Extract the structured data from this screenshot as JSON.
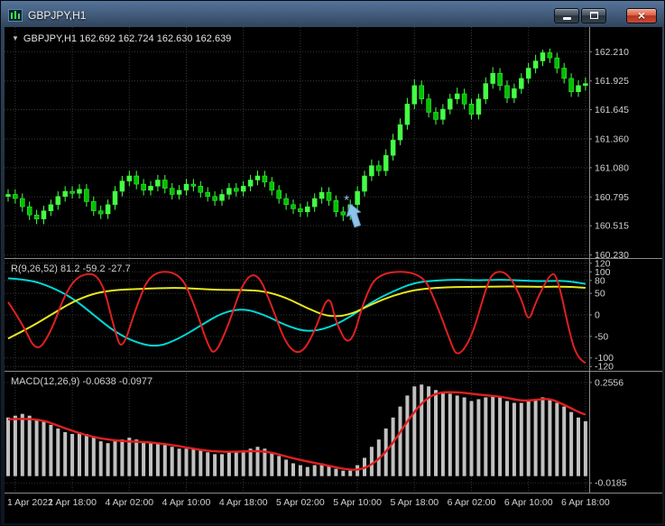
{
  "window": {
    "title": "GBPJPY,H1",
    "controls": {
      "close_glyph": "×"
    }
  },
  "overlay": {
    "collapse_icon": "▼",
    "ohlc_line": "GBPJPY,H1 162.692 162.724 162.630 162.639"
  },
  "panels": {
    "r_label": "R(9,26,52) 81.2 -59.2 -27.7",
    "macd_label": "MACD(12,26,9) -0.0638 -0.0977"
  },
  "axes": {
    "price": [
      "162.210",
      "161.925",
      "161.645",
      "161.360",
      "161.080",
      "160.795",
      "160.515",
      "160.230"
    ],
    "r": [
      "120",
      "100",
      "80",
      "50",
      "0",
      "-50",
      "-100",
      "-120"
    ],
    "macd": [
      "0.2556",
      "-0.0185"
    ],
    "time": [
      "1 Apr 2022",
      "1 Apr 18:00",
      "4 Apr 02:00",
      "4 Apr 10:00",
      "4 Apr 18:00",
      "5 Apr 02:00",
      "5 Apr 10:00",
      "5 Apr 18:00",
      "6 Apr 02:00",
      "6 Apr 10:00",
      "6 Apr 18:00"
    ]
  },
  "colors": {
    "background": "#000000",
    "bull": "#44ff44",
    "bear": "#00c000",
    "wick": "#44ff44",
    "grid": "#383838",
    "separator": "#8a8a8a",
    "axis_text": "#d2d2d2",
    "annotation": "#8fc3ea"
  },
  "chart_data": {
    "type": "candlestick",
    "symbol": "GBPJPY",
    "timeframe": "H1",
    "title": "GBPJPY,H1",
    "price_range": [
      160.2,
      162.45
    ],
    "time_grid_candles": [
      1,
      9,
      17,
      25,
      33,
      41,
      49,
      57,
      65,
      73,
      81
    ],
    "candles": [
      [
        160.8,
        160.87,
        160.75,
        160.82
      ],
      [
        160.82,
        160.87,
        160.73,
        160.78
      ],
      [
        160.78,
        160.83,
        160.65,
        160.7
      ],
      [
        160.7,
        160.75,
        160.57,
        160.62
      ],
      [
        160.62,
        160.67,
        160.53,
        160.58
      ],
      [
        160.58,
        160.71,
        160.53,
        160.66
      ],
      [
        160.66,
        160.77,
        160.61,
        160.72
      ],
      [
        160.72,
        160.85,
        160.67,
        160.8
      ],
      [
        160.8,
        160.9,
        160.75,
        160.85
      ],
      [
        160.85,
        160.9,
        160.78,
        160.83
      ],
      [
        160.83,
        160.92,
        160.78,
        160.87
      ],
      [
        160.87,
        160.92,
        160.7,
        160.75
      ],
      [
        160.75,
        160.8,
        160.61,
        160.66
      ],
      [
        160.66,
        160.71,
        160.58,
        160.63
      ],
      [
        160.63,
        160.77,
        160.58,
        160.72
      ],
      [
        160.72,
        160.9,
        160.67,
        160.85
      ],
      [
        160.85,
        161.0,
        160.8,
        160.95
      ],
      [
        160.95,
        161.05,
        160.9,
        161.0
      ],
      [
        161.0,
        161.05,
        160.87,
        160.92
      ],
      [
        160.92,
        160.97,
        160.81,
        160.86
      ],
      [
        160.86,
        160.95,
        160.81,
        160.9
      ],
      [
        160.9,
        161.01,
        160.85,
        160.96
      ],
      [
        160.96,
        161.01,
        160.83,
        160.88
      ],
      [
        160.88,
        160.93,
        160.77,
        160.82
      ],
      [
        160.82,
        160.91,
        160.77,
        160.86
      ],
      [
        160.86,
        160.97,
        160.81,
        160.92
      ],
      [
        160.92,
        160.97,
        160.85,
        160.9
      ],
      [
        160.9,
        160.95,
        160.79,
        160.84
      ],
      [
        160.84,
        160.89,
        160.75,
        160.8
      ],
      [
        160.8,
        160.85,
        160.71,
        160.76
      ],
      [
        160.76,
        160.87,
        160.71,
        160.82
      ],
      [
        160.82,
        160.93,
        160.77,
        160.88
      ],
      [
        160.88,
        160.93,
        160.8,
        160.85
      ],
      [
        160.85,
        160.95,
        160.8,
        160.9
      ],
      [
        160.9,
        161.01,
        160.85,
        160.96
      ],
      [
        160.96,
        161.05,
        160.91,
        161.0
      ],
      [
        161.0,
        161.05,
        160.89,
        160.94
      ],
      [
        160.94,
        160.99,
        160.81,
        160.86
      ],
      [
        160.86,
        160.91,
        160.73,
        160.78
      ],
      [
        160.78,
        160.83,
        160.67,
        160.72
      ],
      [
        160.72,
        160.77,
        160.63,
        160.68
      ],
      [
        160.68,
        160.73,
        160.6,
        160.65
      ],
      [
        160.65,
        160.75,
        160.6,
        160.7
      ],
      [
        160.7,
        160.83,
        160.65,
        160.78
      ],
      [
        160.78,
        160.89,
        160.73,
        160.84
      ],
      [
        160.84,
        160.89,
        160.71,
        160.76
      ],
      [
        160.76,
        160.81,
        160.6,
        160.65
      ],
      [
        160.65,
        160.7,
        160.56,
        160.62
      ],
      [
        160.62,
        160.77,
        160.57,
        160.72
      ],
      [
        160.72,
        160.9,
        160.67,
        160.85
      ],
      [
        160.85,
        161.05,
        160.8,
        161.0
      ],
      [
        161.0,
        161.16,
        160.95,
        161.1
      ],
      [
        161.1,
        161.15,
        161.0,
        161.05
      ],
      [
        161.05,
        161.26,
        161.0,
        161.2
      ],
      [
        161.2,
        161.41,
        161.15,
        161.35
      ],
      [
        161.35,
        161.56,
        161.3,
        161.5
      ],
      [
        161.5,
        161.76,
        161.45,
        161.7
      ],
      [
        161.7,
        161.94,
        161.65,
        161.88
      ],
      [
        161.88,
        161.93,
        161.7,
        161.75
      ],
      [
        161.75,
        161.8,
        161.57,
        161.62
      ],
      [
        161.62,
        161.67,
        161.5,
        161.55
      ],
      [
        161.55,
        161.7,
        161.5,
        161.65
      ],
      [
        161.65,
        161.8,
        161.6,
        161.75
      ],
      [
        161.75,
        161.86,
        161.7,
        161.8
      ],
      [
        161.8,
        161.85,
        161.65,
        161.7
      ],
      [
        161.7,
        161.75,
        161.55,
        161.6
      ],
      [
        161.6,
        161.8,
        161.55,
        161.75
      ],
      [
        161.75,
        161.96,
        161.7,
        161.9
      ],
      [
        161.9,
        162.06,
        161.85,
        162.0
      ],
      [
        162.0,
        162.05,
        161.83,
        161.88
      ],
      [
        161.88,
        161.93,
        161.71,
        161.76
      ],
      [
        161.76,
        161.9,
        161.71,
        161.85
      ],
      [
        161.85,
        162.0,
        161.8,
        161.95
      ],
      [
        161.95,
        162.1,
        161.9,
        162.05
      ],
      [
        162.05,
        162.18,
        162.0,
        162.12
      ],
      [
        162.12,
        162.23,
        162.07,
        162.2
      ],
      [
        162.2,
        162.24,
        162.1,
        162.15
      ],
      [
        162.15,
        162.2,
        162.0,
        162.05
      ],
      [
        162.05,
        162.1,
        161.9,
        161.95
      ],
      [
        161.95,
        162.0,
        161.77,
        161.82
      ],
      [
        161.82,
        161.93,
        161.77,
        161.88
      ],
      [
        161.88,
        161.96,
        161.83,
        161.9
      ]
    ],
    "indicators": [
      {
        "name": "R(9,26,52)",
        "range": [
          -130,
          130
        ],
        "series": [
          {
            "name": "fast",
            "color": "#e02020",
            "points": [
              [
                0,
                30
              ],
              [
                2,
                -20
              ],
              [
                4,
                -90
              ],
              [
                6,
                -40
              ],
              [
                8,
                50
              ],
              [
                10,
                95
              ],
              [
                13,
                95
              ],
              [
                15,
                -40
              ],
              [
                16,
                -85
              ],
              [
                18,
                20
              ],
              [
                20,
                100
              ],
              [
                24,
                100
              ],
              [
                26,
                30
              ],
              [
                28,
                -70
              ],
              [
                29,
                -95
              ],
              [
                31,
                -20
              ],
              [
                33,
                80
              ],
              [
                35,
                100
              ],
              [
                37,
                20
              ],
              [
                39,
                -70
              ],
              [
                41,
                -95
              ],
              [
                43,
                -40
              ],
              [
                45,
                55
              ],
              [
                46,
                -20
              ],
              [
                48,
                -80
              ],
              [
                50,
                40
              ],
              [
                52,
                100
              ],
              [
                58,
                100
              ],
              [
                60,
                30
              ],
              [
                62,
                -60
              ],
              [
                63,
                -100
              ],
              [
                65,
                -55
              ],
              [
                67,
                60
              ],
              [
                68,
                100
              ],
              [
                70,
                100
              ],
              [
                72,
                40
              ],
              [
                73,
                -20
              ],
              [
                74,
                30
              ],
              [
                76,
                95
              ],
              [
                77,
                95
              ],
              [
                79,
                -60
              ],
              [
                80,
                -100
              ],
              [
                81,
                -112
              ]
            ]
          },
          {
            "name": "slow",
            "color": "#00d8d8",
            "points": [
              [
                0,
                85
              ],
              [
                3,
                82
              ],
              [
                6,
                65
              ],
              [
                9,
                40
              ],
              [
                12,
                0
              ],
              [
                15,
                -40
              ],
              [
                18,
                -65
              ],
              [
                21,
                -75
              ],
              [
                24,
                -55
              ],
              [
                27,
                -25
              ],
              [
                30,
                5
              ],
              [
                33,
                15
              ],
              [
                36,
                0
              ],
              [
                39,
                -25
              ],
              [
                42,
                -40
              ],
              [
                45,
                -30
              ],
              [
                48,
                -5
              ],
              [
                51,
                30
              ],
              [
                54,
                55
              ],
              [
                57,
                75
              ],
              [
                60,
                80
              ],
              [
                63,
                82
              ],
              [
                66,
                80
              ],
              [
                69,
                82
              ],
              [
                72,
                80
              ],
              [
                75,
                78
              ],
              [
                78,
                80
              ],
              [
                81,
                72
              ]
            ]
          },
          {
            "name": "signal",
            "color": "#e8e820",
            "points": [
              [
                0,
                -55
              ],
              [
                3,
                -30
              ],
              [
                6,
                0
              ],
              [
                9,
                30
              ],
              [
                12,
                50
              ],
              [
                15,
                58
              ],
              [
                18,
                60
              ],
              [
                21,
                62
              ],
              [
                24,
                63
              ],
              [
                27,
                60
              ],
              [
                30,
                58
              ],
              [
                33,
                58
              ],
              [
                36,
                55
              ],
              [
                39,
                40
              ],
              [
                42,
                15
              ],
              [
                45,
                -5
              ],
              [
                48,
                0
              ],
              [
                51,
                25
              ],
              [
                54,
                45
              ],
              [
                57,
                58
              ],
              [
                60,
                63
              ],
              [
                63,
                65
              ],
              [
                66,
                65
              ],
              [
                69,
                66
              ],
              [
                72,
                66
              ],
              [
                75,
                65
              ],
              [
                78,
                66
              ],
              [
                81,
                63
              ]
            ]
          }
        ]
      },
      {
        "name": "MACD(12,26,9)",
        "range": [
          -0.045,
          0.285
        ],
        "histogram_color": "#c0c0c0",
        "signal_color": "#e02020",
        "histogram": [
          0.16,
          0.165,
          0.17,
          0.165,
          0.155,
          0.15,
          0.14,
          0.13,
          0.12,
          0.115,
          0.12,
          0.115,
          0.105,
          0.095,
          0.09,
          0.095,
          0.1,
          0.105,
          0.1,
          0.095,
          0.09,
          0.09,
          0.085,
          0.08,
          0.075,
          0.075,
          0.075,
          0.07,
          0.065,
          0.06,
          0.06,
          0.065,
          0.065,
          0.07,
          0.075,
          0.08,
          0.075,
          0.065,
          0.055,
          0.045,
          0.035,
          0.03,
          0.025,
          0.03,
          0.035,
          0.03,
          0.02,
          0.015,
          0.015,
          0.03,
          0.05,
          0.08,
          0.1,
          0.13,
          0.16,
          0.19,
          0.22,
          0.245,
          0.25,
          0.245,
          0.235,
          0.23,
          0.225,
          0.22,
          0.215,
          0.205,
          0.21,
          0.215,
          0.22,
          0.215,
          0.205,
          0.2,
          0.2,
          0.205,
          0.21,
          0.215,
          0.21,
          0.2,
          0.19,
          0.175,
          0.16,
          0.15
        ],
        "signal_points": [
          [
            0,
            0.155
          ],
          [
            4,
            0.16
          ],
          [
            8,
            0.13
          ],
          [
            12,
            0.105
          ],
          [
            16,
            0.095
          ],
          [
            20,
            0.093
          ],
          [
            24,
            0.082
          ],
          [
            28,
            0.068
          ],
          [
            32,
            0.066
          ],
          [
            36,
            0.07
          ],
          [
            40,
            0.048
          ],
          [
            44,
            0.032
          ],
          [
            48,
            0.016
          ],
          [
            50,
            0.02
          ],
          [
            52,
            0.045
          ],
          [
            54,
            0.09
          ],
          [
            56,
            0.15
          ],
          [
            58,
            0.2
          ],
          [
            60,
            0.228
          ],
          [
            63,
            0.23
          ],
          [
            66,
            0.222
          ],
          [
            69,
            0.218
          ],
          [
            72,
            0.205
          ],
          [
            74,
            0.208
          ],
          [
            76,
            0.212
          ],
          [
            78,
            0.195
          ],
          [
            80,
            0.175
          ],
          [
            81,
            0.168
          ]
        ]
      }
    ],
    "annotation": {
      "type": "up-arrow",
      "candle": 48,
      "price": 160.51,
      "color": "#8fc3ea"
    }
  }
}
